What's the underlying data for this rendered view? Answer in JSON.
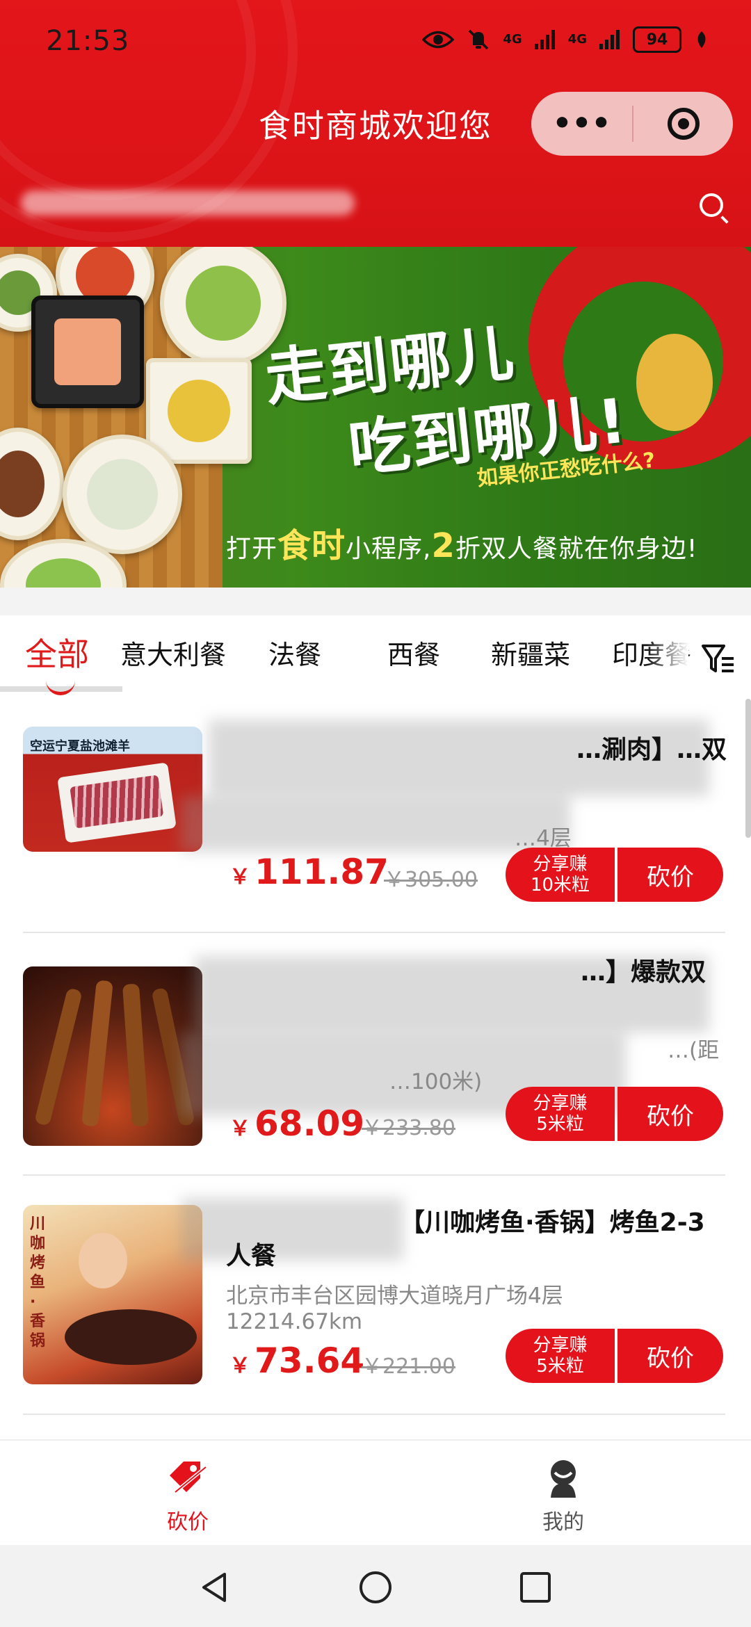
{
  "status_bar": {
    "time": "21:53",
    "signal1": "4G",
    "signal2": "4G",
    "battery": "94"
  },
  "header": {
    "title": "食时商城欢迎您",
    "capsule_more": "•••"
  },
  "banner": {
    "line1": "走到哪儿",
    "line2": "吃到哪儿!",
    "subtitle": "如果你正愁吃什么?",
    "footer_pre": "打开",
    "footer_hl1": "食时",
    "footer_mid": "小程序,",
    "footer_hl2": "2",
    "footer_post": "折双人餐就在你身边!"
  },
  "category_tabs": [
    {
      "label": "全部",
      "active": true
    },
    {
      "label": "意大利餐"
    },
    {
      "label": "法餐"
    },
    {
      "label": "西餐"
    },
    {
      "label": "新疆菜"
    },
    {
      "label": "印度餐"
    }
  ],
  "products": [
    {
      "name": "…涮肉】…双",
      "addr": "…4层",
      "dist": "",
      "price": "111.87",
      "orig_price": "￥305.00",
      "share_line1": "分享赚",
      "share_line2": "10米粒",
      "cut_label": "砍价",
      "thumb_caption": "空运宁夏盐池滩羊"
    },
    {
      "name": "…】爆款双",
      "addr": "…(距",
      "dist": "…100米)",
      "price": "68.09",
      "orig_price": "￥233.80",
      "share_line1": "分享赚",
      "share_line2": "5米粒",
      "cut_label": "砍价"
    },
    {
      "name": "【川咖烤鱼·香锅】烤鱼2-3人餐",
      "addr": "北京市丰台区园博大道晓月广场4层",
      "dist": "12214.67km",
      "price": "73.64",
      "orig_price": "￥221.00",
      "share_line1": "分享赚",
      "share_line2": "5米粒",
      "cut_label": "砍价",
      "thumb_caption": "川咖 烤鱼·香锅"
    }
  ],
  "currency": "￥",
  "tabbar": {
    "bargain": "砍价",
    "mine": "我的"
  },
  "colors": {
    "brand_red": "#e4131b",
    "header_red": "#dd1418"
  }
}
